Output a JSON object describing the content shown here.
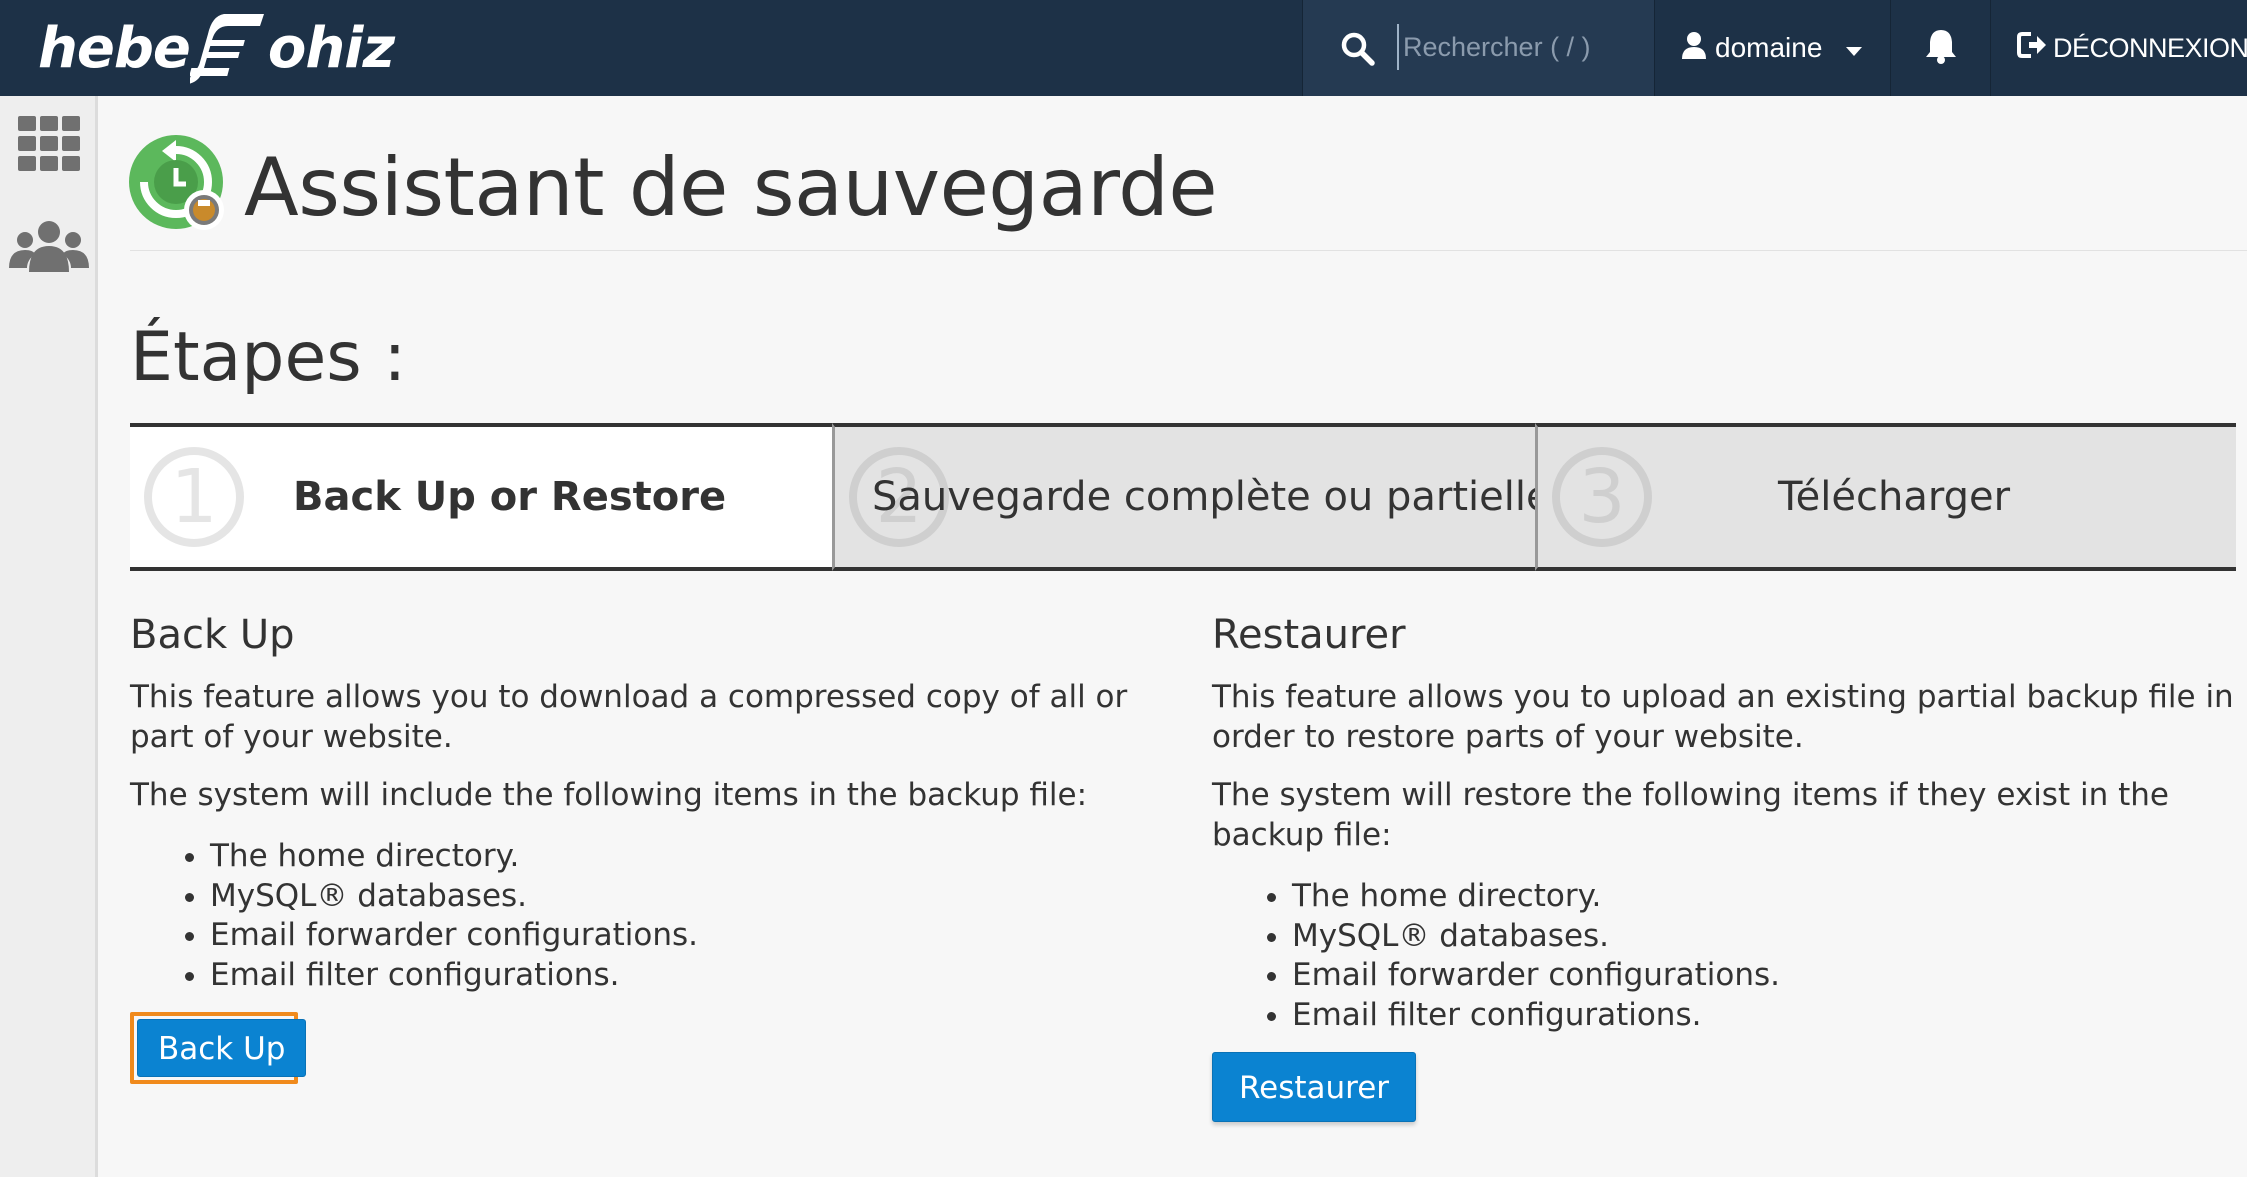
{
  "topbar": {
    "logo_left": "hebe",
    "logo_right": "ohiz",
    "search_placeholder": "Rechercher ( / )",
    "user_name": "domaine",
    "logout_label": "DÉCONNEXION"
  },
  "rail": {
    "items": [
      "grid-icon",
      "users-icon"
    ]
  },
  "page": {
    "title": "Assistant de sauvegarde",
    "steps_title": "Étapes :"
  },
  "steps": [
    {
      "number": "1",
      "label": "Back Up or Restore",
      "active": true
    },
    {
      "number": "2",
      "label": "Sauvegarde complète ou partielle",
      "active": false
    },
    {
      "number": "3",
      "label": "Télécharger",
      "active": false
    }
  ],
  "backup": {
    "heading": "Back Up",
    "description": "This feature allows you to download a compressed copy of all or part of your website.",
    "intro": "The system will include the following items in the backup file:",
    "items": [
      "The home directory.",
      "MySQL® databases.",
      "Email forwarder configurations.",
      "Email filter configurations."
    ],
    "button_label": "Back Up"
  },
  "restore": {
    "heading": "Restaurer",
    "description": "This feature allows you to upload an existing partial backup file in order to restore parts of your website.",
    "intro": "The system will restore the following items if they exist in the backup file:",
    "items": [
      "The home directory.",
      "MySQL® databases.",
      "Email forwarder configurations.",
      "Email filter configurations."
    ],
    "button_label": "Restaurer"
  },
  "colors": {
    "topbar": "#1d3147",
    "button": "#0b83d1",
    "highlight": "#f08a1c"
  }
}
